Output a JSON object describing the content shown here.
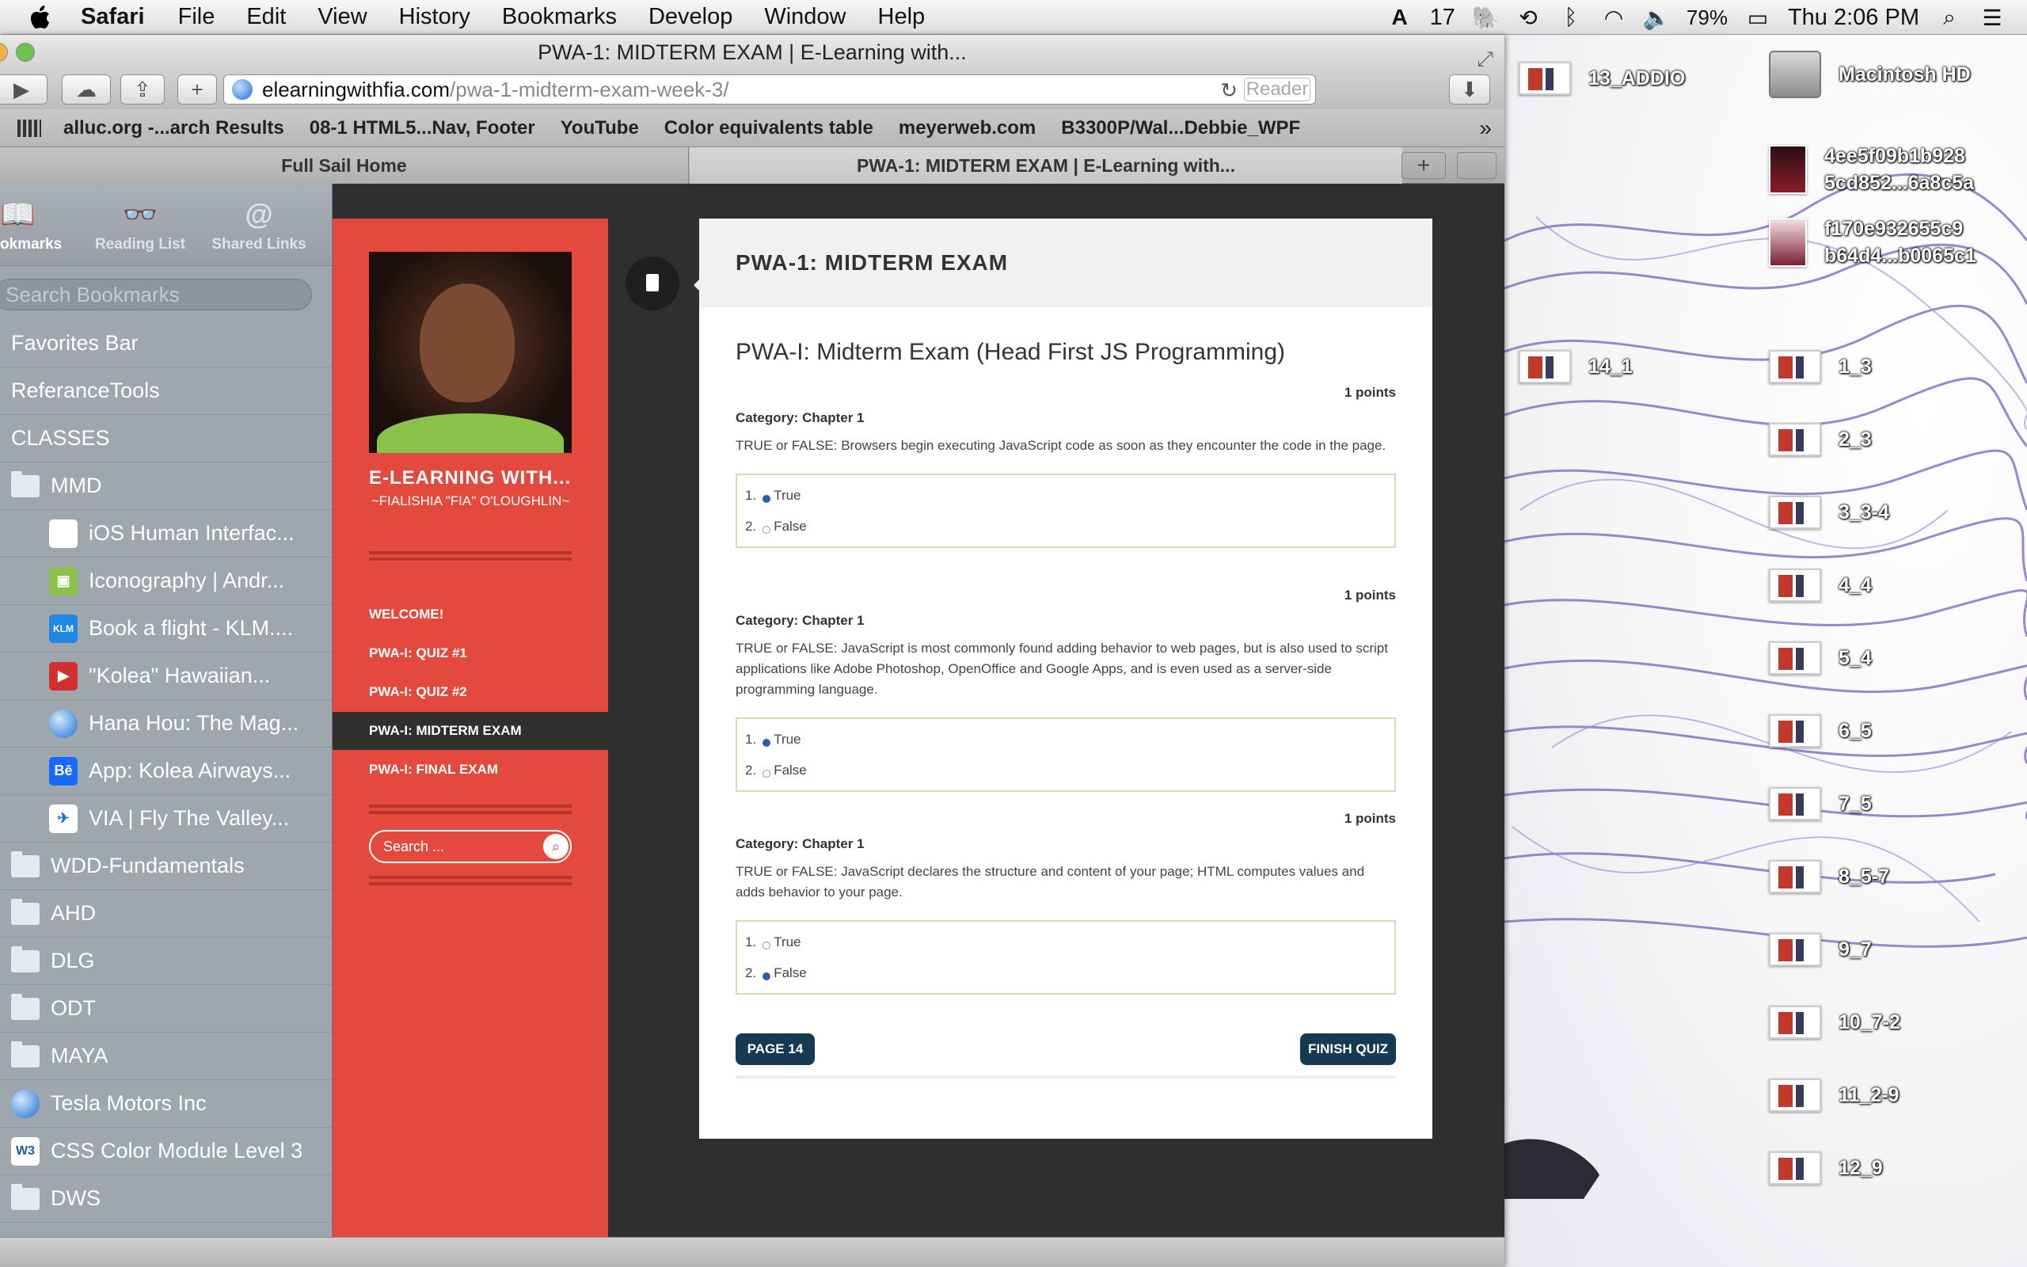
{
  "menubar": {
    "app": "Safari",
    "items": [
      "File",
      "Edit",
      "View",
      "History",
      "Bookmarks",
      "Develop",
      "Window",
      "Help"
    ],
    "status": {
      "notif_count": "17",
      "battery": "79%",
      "clock": "Thu 2:06 PM"
    }
  },
  "window": {
    "title": "PWA-1: MIDTERM EXAM | E-Learning with..."
  },
  "url": {
    "domain": "elearningwithfia.com",
    "path": "/pwa-1-midterm-exam-week-3/",
    "reader": "Reader"
  },
  "bookmarks_bar": [
    "alluc.org -...arch Results",
    "08-1 HTML5...Nav, Footer",
    "YouTube",
    "Color equivalents table",
    "meyerweb.com",
    "B3300P/Wal...Debbie_WPF"
  ],
  "tabs": [
    "Full Sail Home",
    "PWA-1: MIDTERM EXAM | E-Learning with..."
  ],
  "sidebar": {
    "tabs": [
      "okmarks",
      "Reading List",
      "Shared Links"
    ],
    "search_placeholder": "Search Bookmarks",
    "items": [
      {
        "label": "Favorites Bar"
      },
      {
        "label": "ReferanceTools"
      },
      {
        "label": "CLASSES"
      },
      {
        "label": "MMD"
      },
      {
        "label": "iOS Human Interfac..."
      },
      {
        "label": "Iconography | Andr..."
      },
      {
        "label": "Book a flight - KLM...."
      },
      {
        "label": "\"Kolea\" Hawaiian..."
      },
      {
        "label": "Hana Hou: The Mag..."
      },
      {
        "label": "App: Kolea Airways..."
      },
      {
        "label": "VIA | Fly The Valley..."
      },
      {
        "label": "WDD-Fundamentals"
      },
      {
        "label": "AHD"
      },
      {
        "label": "DLG"
      },
      {
        "label": "ODT"
      },
      {
        "label": "MAYA"
      },
      {
        "label": "Tesla Motors Inc"
      },
      {
        "label": "CSS Color Module Level 3"
      },
      {
        "label": "DWS"
      }
    ]
  },
  "site": {
    "title": "E-LEARNING WITH...",
    "tagline": "~FIALISHIA \"FIA\" O'LOUGHLIN~",
    "nav": [
      "WELCOME!",
      "PWA-I: QUIZ #1",
      "PWA-I: QUIZ #2",
      "PWA-I: MIDTERM EXAM",
      "PWA-I: FINAL EXAM"
    ],
    "search_placeholder": "Search ..."
  },
  "post": {
    "header": "PWA-1: MIDTERM EXAM",
    "quiz_title": "PWA-I: Midterm Exam (Head First JS Programming)",
    "questions": [
      {
        "points": "1 points",
        "category_label": "Category:",
        "category": "Chapter 1",
        "text": "TRUE or FALSE:  Browsers begin executing JavaScript code as soon as they encounter the code in the page.",
        "answers": [
          {
            "num": "1.",
            "label": "True",
            "selected": true
          },
          {
            "num": "2.",
            "label": "False",
            "selected": false
          }
        ]
      },
      {
        "points": "1 points",
        "category_label": "Category:",
        "category": "Chapter 1",
        "text": "TRUE or FALSE:  JavaScript is most commonly found adding behavior to web pages, but is also used to script applications like Adobe Photoshop, OpenOffice and Google Apps, and is even used as a server-side programming language.",
        "answers": [
          {
            "num": "1.",
            "label": "True",
            "selected": true
          },
          {
            "num": "2.",
            "label": "False",
            "selected": false
          }
        ]
      },
      {
        "points": "1 points",
        "category_label": "Category:",
        "category": "Chapter 1",
        "text": "TRUE or FALSE:  JavaScript declares the structure and content of your page; HTML computes values and adds behavior to your page.",
        "answers": [
          {
            "num": "1.",
            "label": "True",
            "selected": false
          },
          {
            "num": "2.",
            "label": "False",
            "selected": true
          }
        ]
      }
    ],
    "page_button": "PAGE 14",
    "finish_button": "FINISH QUIZ"
  },
  "desktop": {
    "icons": [
      "13_ADDIO",
      "Macintosh HD",
      "4ee5f09b1b928\n5cd852...6a8c5a",
      "f170e932655c9\nb64d4...b0065c1",
      "14_1",
      "1_3",
      "2_3",
      "3_3-4",
      "4_4",
      "5_4",
      "6_5",
      "7_5",
      "8_5-7",
      "9_7",
      "10_7-2",
      "11_2-9",
      "12_9"
    ]
  }
}
